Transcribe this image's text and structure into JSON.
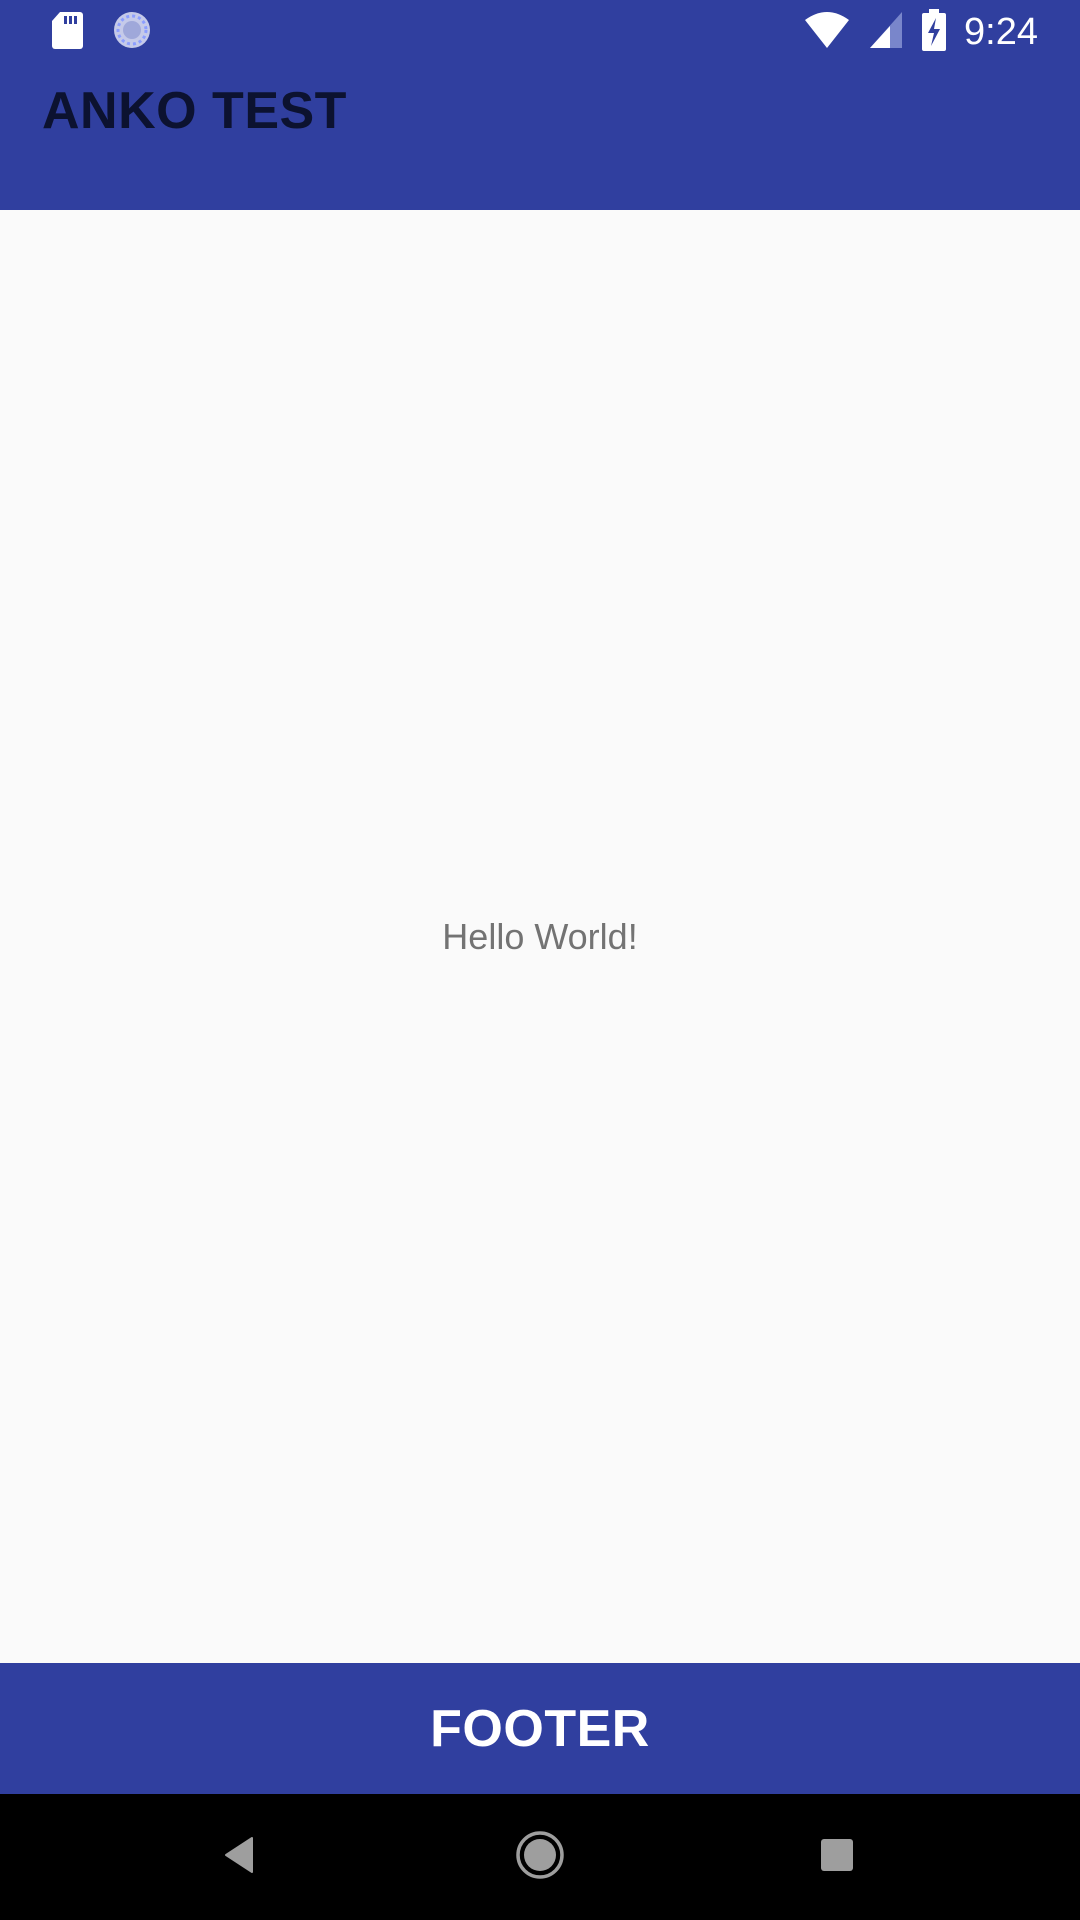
{
  "status_bar": {
    "time": "9:24",
    "icons": [
      "sd-card-icon",
      "sync-icon",
      "wifi-icon",
      "cell-signal-icon",
      "battery-charging-icon"
    ]
  },
  "app_bar": {
    "title": "ANKO TEST"
  },
  "main": {
    "text": "Hello World!"
  },
  "footer": {
    "label": "FOOTER"
  },
  "navigation": {
    "buttons": [
      "back",
      "home",
      "recents"
    ]
  },
  "colors": {
    "primary": "#303f9f",
    "background": "#fafafa",
    "title_text": "#0c1230",
    "body_text": "#737373",
    "nav_bar": "#000000"
  }
}
